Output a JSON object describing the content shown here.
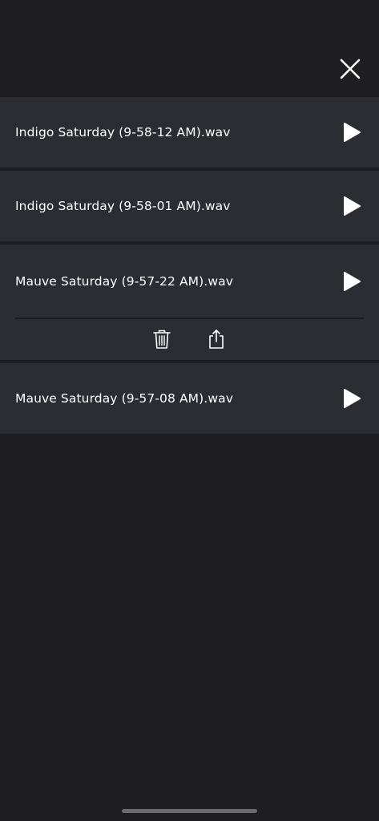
{
  "recordings": [
    {
      "name": "Indigo Saturday (9-58-12 AM).wav",
      "play_icon": "play-icon"
    },
    {
      "name": "Indigo Saturday (9-58-01 AM).wav",
      "play_icon": "play-icon"
    },
    {
      "name": "Mauve Saturday (9-57-22 AM).wav",
      "play_icon": "play-icon",
      "expanded": true
    },
    {
      "name": "Mauve Saturday (9-57-08 AM).wav",
      "play_icon": "play-icon"
    }
  ],
  "icons": {
    "close": "close-icon",
    "play": "play-icon",
    "delete": "trash-icon",
    "share": "share-icon"
  },
  "colors": {
    "background": "#1f1f22",
    "item_background": "#2c2c33",
    "text": "#ffffff"
  }
}
